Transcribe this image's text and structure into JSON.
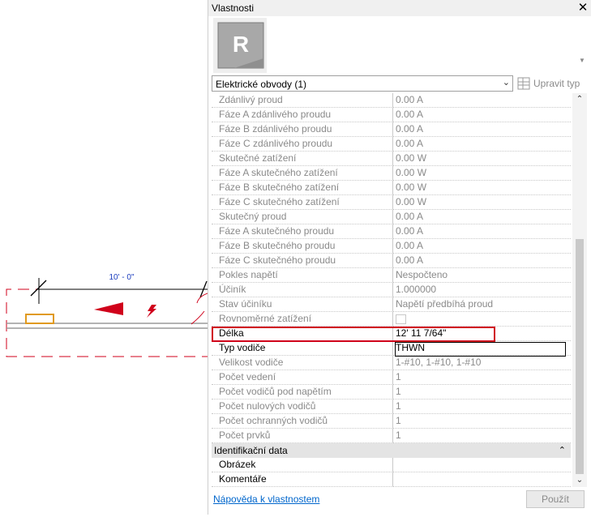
{
  "canvas": {
    "dimension_text": "10' - 0\"",
    "colors": {
      "circuit": "#d0021b",
      "fixture": "#e09a1f",
      "conduit": "#9a9a9a"
    }
  },
  "panel": {
    "title": "Vlastnosti",
    "close_glyph": "✕",
    "logo_letter": "R",
    "selector": {
      "value": "Elektrické obvody (1)",
      "arrow": "⌄"
    },
    "edit_type_label": "Upravit typ",
    "rows": [
      {
        "name": "Zdánlivý proud",
        "value": "0.00 A"
      },
      {
        "name": "Fáze A zdánlivého proudu",
        "value": "0.00 A"
      },
      {
        "name": "Fáze B zdánlivého proudu",
        "value": "0.00 A"
      },
      {
        "name": "Fáze C zdánlivého proudu",
        "value": "0.00 A"
      },
      {
        "name": "Skutečné zatížení",
        "value": "0.00 W"
      },
      {
        "name": "Fáze A skutečného zatížení",
        "value": "0.00 W"
      },
      {
        "name": "Fáze B skutečného zatížení",
        "value": "0.00 W"
      },
      {
        "name": "Fáze C skutečného zatížení",
        "value": "0.00 W"
      },
      {
        "name": "Skutečný proud",
        "value": "0.00 A"
      },
      {
        "name": "Fáze A skutečného proudu",
        "value": "0.00 A"
      },
      {
        "name": "Fáze B skutečného proudu",
        "value": "0.00 A"
      },
      {
        "name": "Fáze C skutečného proudu",
        "value": "0.00 A"
      },
      {
        "name": "Pokles napětí",
        "value": "Nespočteno"
      },
      {
        "name": "Účiník",
        "value": "1.000000"
      },
      {
        "name": "Stav účiníku",
        "value": "Napětí předbíhá proud"
      },
      {
        "name": "Rovnoměrné zatížení",
        "value": ""
      },
      {
        "name": "Délka",
        "value": "12'  11 7/64\""
      },
      {
        "name": "Typ vodiče",
        "value": "THWN"
      },
      {
        "name": "Velikost vodiče",
        "value": "1-#10, 1-#10, 1-#10"
      },
      {
        "name": "Počet vedení",
        "value": "1"
      },
      {
        "name": "Počet vodičů pod napětím",
        "value": "1"
      },
      {
        "name": "Počet nulových vodičů",
        "value": "1"
      },
      {
        "name": "Počet ochranných vodičů",
        "value": "1"
      },
      {
        "name": "Počet prvků",
        "value": "1"
      }
    ],
    "group": {
      "label": "Identifikační data",
      "collapse_glyph": "⌃"
    },
    "group_rows": [
      {
        "name": "Obrázek",
        "value": ""
      },
      {
        "name": "Komentáře",
        "value": ""
      }
    ],
    "scroll": {
      "up": "⌃",
      "down": "⌄"
    },
    "help_link": "Nápověda k vlastnostem",
    "apply_label": "Použít"
  }
}
